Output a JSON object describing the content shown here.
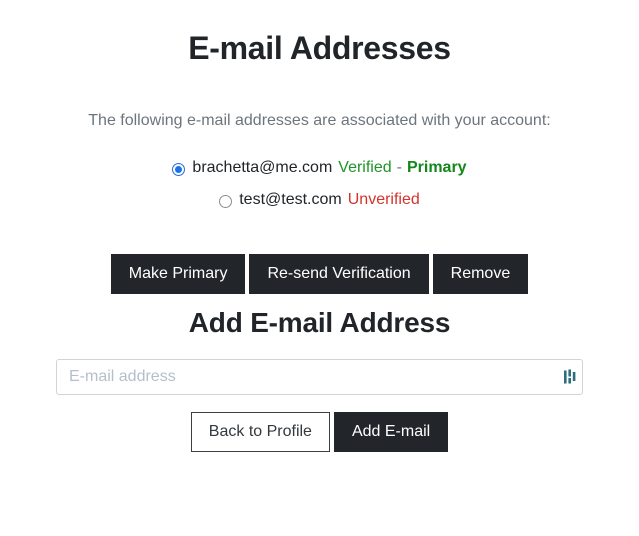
{
  "page": {
    "title": "E-mail Addresses",
    "intro": "The following e-mail addresses are associated with your account:"
  },
  "emails": [
    {
      "address": "brachetta@me.com",
      "status": "Verified",
      "status_type": "verified",
      "separator": "-",
      "primary_label": "Primary",
      "is_primary": true,
      "selected": true
    },
    {
      "address": "test@test.com",
      "status": "Unverified",
      "status_type": "unverified",
      "separator": "",
      "primary_label": "",
      "is_primary": false,
      "selected": false
    }
  ],
  "actions": {
    "make_primary": "Make Primary",
    "resend_verification": "Re-send Verification",
    "remove": "Remove"
  },
  "add_form": {
    "heading": "Add E-mail Address",
    "input_placeholder": "E-mail address",
    "input_value": "",
    "autofill_icon": "password-manager-autofill-icon",
    "back_button": "Back to Profile",
    "submit_button": "Add E-mail"
  },
  "colors": {
    "text": "#212529",
    "muted": "#6c757d",
    "verified_green": "#1f9427",
    "primary_green": "#14861b",
    "unverified_red": "#d6322c",
    "button_dark": "#22262b",
    "input_border": "#ced4da",
    "autofill_teal": "#2d6e7e"
  }
}
